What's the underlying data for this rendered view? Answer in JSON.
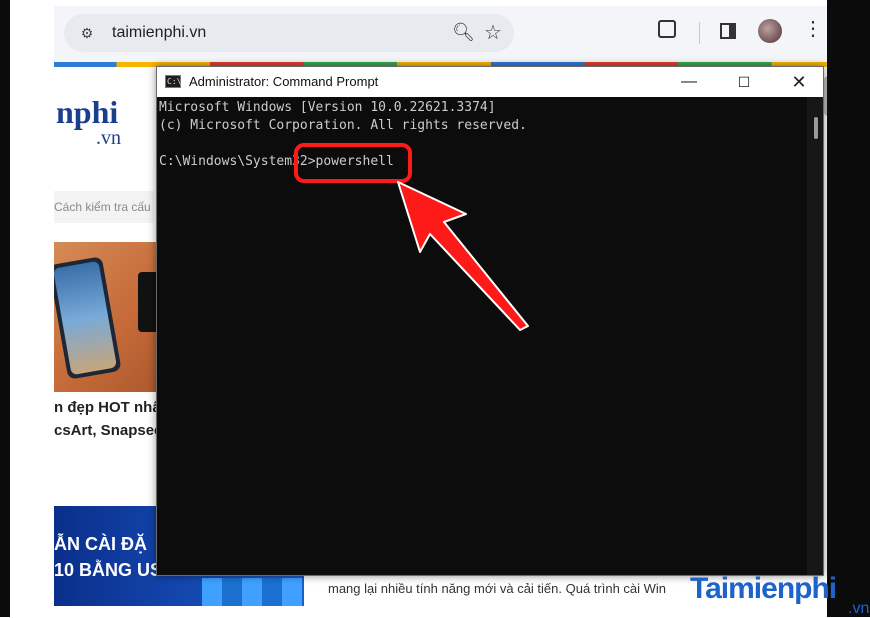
{
  "browser": {
    "url": "taimienphi.vn",
    "icons": {
      "site_info": "tune-icon",
      "zoom": "zoom-icon",
      "bookmark": "star-icon",
      "extensions": "puzzle-icon",
      "side_panel": "side-panel-icon",
      "profile": "avatar",
      "menu": "kebab-menu-icon"
    }
  },
  "website": {
    "logo_main": "nphi",
    "logo_sub": ".vn",
    "search_placeholder": "Cách kiểm tra cấu",
    "headline_1": "n đẹp HOT nhất",
    "headline_2": "csArt, Snapsee",
    "banner_line_1": "ẪN CÀI ĐẶ",
    "banner_line_2": "10 BẰNG US",
    "body_text": "mang lại nhiều tính năng mới và cải tiến. Quá trình cài Win"
  },
  "cmd_window": {
    "title": "Administrator: Command Prompt",
    "icon_text": "C:\\",
    "lines": [
      "Microsoft Windows [Version 10.0.22621.3374]",
      "(c) Microsoft Corporation. All rights reserved.",
      "",
      "C:\\Windows\\System32>powershell"
    ],
    "controls": {
      "minimize": "—",
      "maximize": "☐",
      "close": "✕"
    }
  },
  "annotation": {
    "highlight_color": "#ff1a1a",
    "arrow_color": "#ff1a1a"
  },
  "watermark": {
    "main": "Taimienphi",
    "sub": ".vn"
  }
}
